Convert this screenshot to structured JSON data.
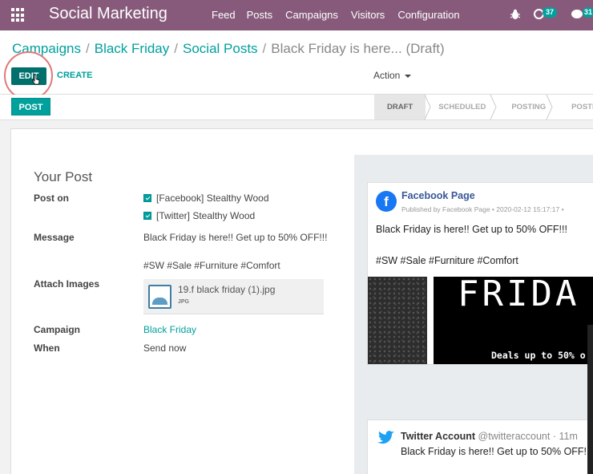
{
  "navbar": {
    "app_title": "Social Marketing",
    "menu": [
      "Feed",
      "Posts",
      "Campaigns",
      "Visitors",
      "Configuration"
    ],
    "activity_count": "37",
    "message_count": "31",
    "color": "#875a7b"
  },
  "breadcrumb": {
    "items": [
      "Campaigns",
      "Black Friday",
      "Social Posts"
    ],
    "current": "Black Friday is here... (Draft)"
  },
  "buttons": {
    "edit": "EDIT",
    "create": "CREATE",
    "action": "Action",
    "post": "POST"
  },
  "status_stages": [
    "DRAFT",
    "SCHEDULED",
    "POSTING",
    "POSTED"
  ],
  "form": {
    "title": "Your Post",
    "post_on_label": "Post on",
    "accounts": [
      "[Facebook] Stealthy Wood",
      "[Twitter] Stealthy Wood"
    ],
    "message_label": "Message",
    "message_line1": "Black Friday is here!! Get up to 50% OFF!!!",
    "message_line2": "#SW #Sale #Furniture #Comfort",
    "attach_label": "Attach Images",
    "attachment_name": "19.f black friday (1).jpg",
    "attachment_type": "JPG",
    "campaign_label": "Campaign",
    "campaign_value": "Black Friday",
    "when_label": "When",
    "when_value": "Send now"
  },
  "facebook_preview": {
    "page_name": "Facebook Page",
    "meta": "Published by Facebook Page • 2020-02-12 15:17:17 •",
    "message": "Black Friday is here!! Get up to 50% OFF!!!",
    "tags": "#SW #Sale #Furniture #Comfort",
    "image_text_big": "FRIDA",
    "image_text_small": "Deals up to 50% o"
  },
  "twitter_preview": {
    "name": "Twitter Account",
    "handle": "@twitteraccount · 11m",
    "message": "Black Friday is here!! Get up to 50% OFF!"
  },
  "accent_color": "#00a09d"
}
